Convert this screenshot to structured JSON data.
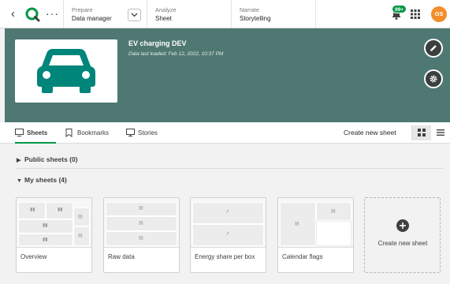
{
  "topbar": {
    "nav": [
      {
        "category": "Prepare",
        "value": "Data manager"
      },
      {
        "category": "Analyze",
        "value": "Sheet"
      },
      {
        "category": "Narrate",
        "value": "Storytelling"
      }
    ],
    "notification_count": "99+",
    "avatar_initials": "GS"
  },
  "app": {
    "title": "EV charging DEV",
    "subtitle": "Data last loaded: Feb 12, 2022, 10:37 PM",
    "header_color": "#4f7872",
    "icon_color": "#00857a"
  },
  "tabs": [
    {
      "label": "Sheets",
      "icon": "sheets-icon",
      "active": true
    },
    {
      "label": "Bookmarks",
      "icon": "bookmark-icon",
      "active": false
    },
    {
      "label": "Stories",
      "icon": "story-icon",
      "active": false
    }
  ],
  "actions": {
    "create_new_sheet": "Create new sheet"
  },
  "sections": {
    "public": "Public sheets (0)",
    "mine": "My sheets (4)"
  },
  "sheets": [
    {
      "name": "Overview"
    },
    {
      "name": "Raw data"
    },
    {
      "name": "Energy share per box"
    },
    {
      "name": "Calendar flags"
    }
  ],
  "new_sheet_card": {
    "label": "Create new sheet"
  },
  "colors": {
    "accent": "#009845",
    "avatar": "#f28e2b"
  }
}
